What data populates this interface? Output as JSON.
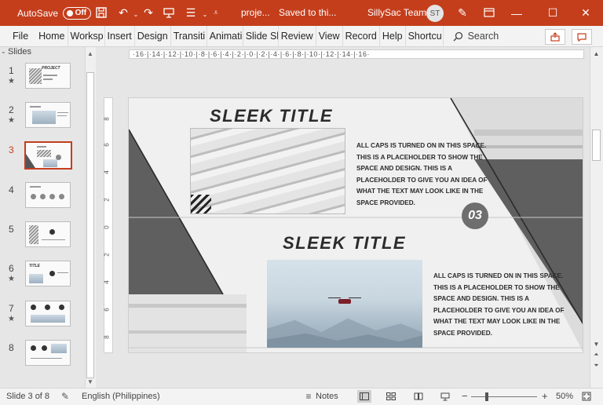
{
  "titlebar": {
    "autosave_label": "AutoSave",
    "autosave_state": "Off",
    "file_title": "proje...",
    "save_status": "Saved to thi...",
    "team": "SillySac Team",
    "avatar_initials": "ST"
  },
  "ribbon": {
    "tabs": [
      "File",
      "Home",
      "Worksp",
      "Insert",
      "Design",
      "Transiti",
      "Animati",
      "Slide Sh",
      "Review",
      "View",
      "Record",
      "Help",
      "Shortcu"
    ],
    "search_label": "Search"
  },
  "slides_pane": {
    "header": "Slides",
    "items": [
      {
        "num": "1",
        "star": true
      },
      {
        "num": "2",
        "star": true
      },
      {
        "num": "3",
        "star": false
      },
      {
        "num": "4",
        "star": false
      },
      {
        "num": "5",
        "star": false
      },
      {
        "num": "6",
        "star": true
      },
      {
        "num": "7",
        "star": true
      },
      {
        "num": "8",
        "star": false
      }
    ],
    "star_glyph": "★"
  },
  "ruler": {
    "h_text": "·16·|·14·|·12·|·10·|·8·|·6·|·4·|·2·|·0·|·2·|·4·|·6·|·8·|·10·|·12·|·14·|·16·",
    "v_labels": [
      "8",
      "6",
      "4",
      "2",
      "0",
      "2",
      "4",
      "6",
      "8"
    ]
  },
  "slide": {
    "title1": "SLEEK TITLE",
    "title2": "SLEEK TITLE",
    "body1": "ALL CAPS IS TURNED ON IN THIS SPACE. THIS IS A PLACEHOLDER TO SHOW THE SPACE AND DESIGN. THIS IS A PLACEHOLDER TO GIVE YOU AN IDEA OF WHAT THE TEXT MAY LOOK LIKE IN THE SPACE PROVIDED.",
    "body2": "ALL CAPS IS TURNED ON IN THIS SPACE. THIS IS A PLACEHOLDER TO SHOW THE SPACE AND DESIGN. THIS IS A PLACEHOLDER TO GIVE YOU AN IDEA OF WHAT THE TEXT MAY LOOK LIKE IN THE SPACE PROVIDED.",
    "badge": "03"
  },
  "statusbar": {
    "slide_info": "Slide 3 of 8",
    "language": "English (Philippines)",
    "notes_label": "Notes",
    "zoom_minus": "−",
    "zoom_plus": "+",
    "zoom_level": "50%"
  },
  "colors": {
    "accent": "#c43e1c",
    "slide_bg": "#f0f0f0",
    "slide_dark": "#5f5f5f"
  }
}
